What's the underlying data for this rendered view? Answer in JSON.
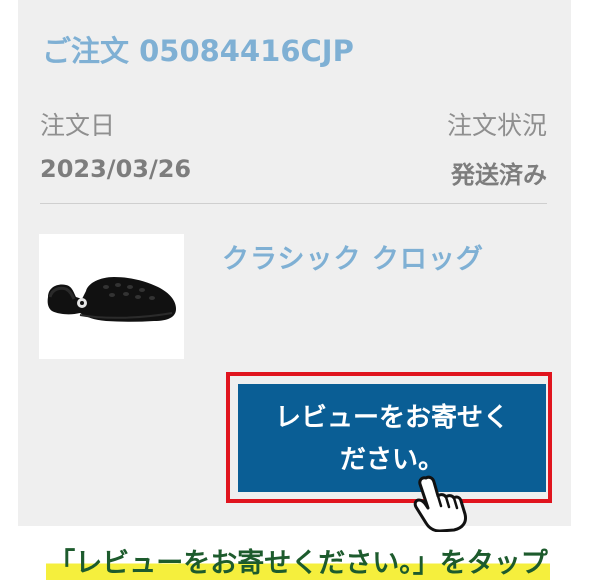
{
  "order": {
    "title": "ご注文 05084416CJP",
    "date_label": "注文日",
    "status_label": "注文状況",
    "date_value": "2023/03/26",
    "status_value": "発送済み"
  },
  "product": {
    "name": "クラシック クロッグ",
    "image_icon": "black-clog-shoe"
  },
  "review_button": {
    "label": "レビューをお寄せください。"
  },
  "instruction": {
    "caption": "「レビューをお寄せください。」をタップ"
  },
  "colors": {
    "accent_blue": "#7fb0d4",
    "button_blue": "#0a5e95",
    "highlight_red": "#e0141e",
    "caption_green": "#1d5b2d",
    "caption_highlight": "#f5ef3d"
  }
}
